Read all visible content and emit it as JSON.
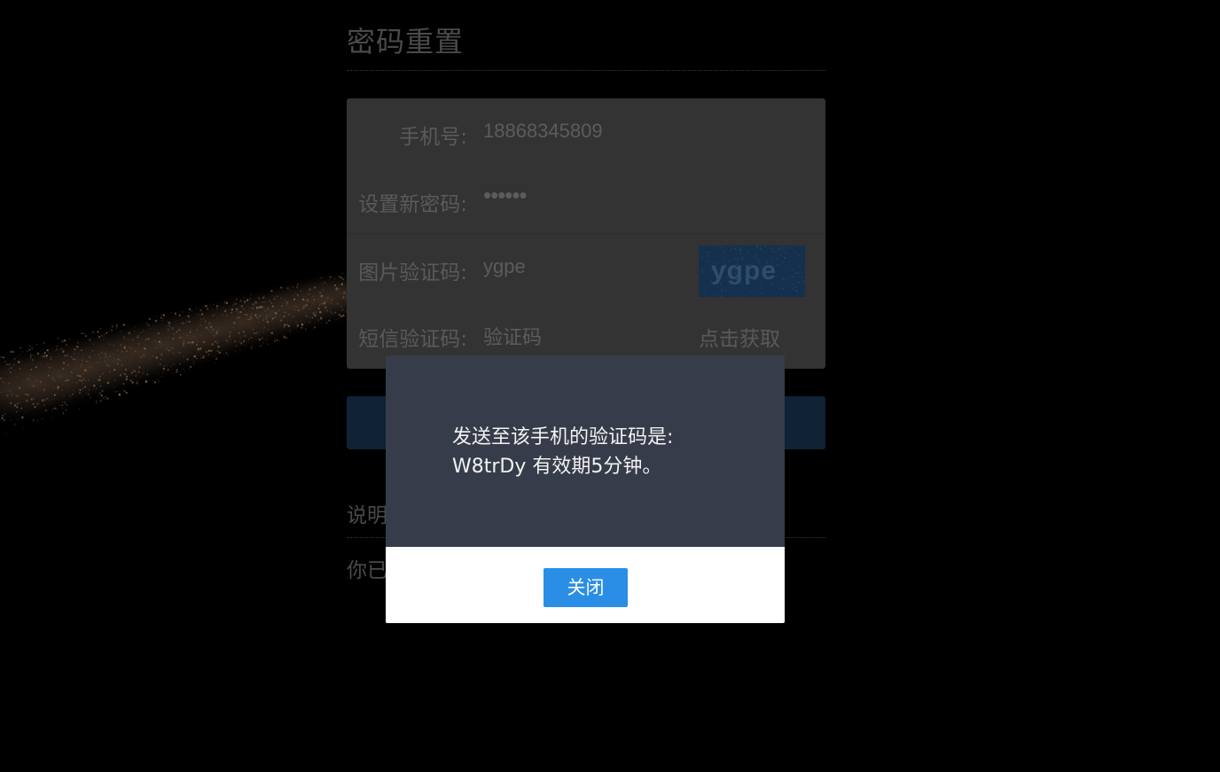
{
  "page": {
    "title": "密码重置"
  },
  "form": {
    "phone": {
      "label": "手机号:",
      "value": "18868345809"
    },
    "new_password": {
      "label": "设置新密码:",
      "value": "••••••"
    },
    "image_captcha": {
      "label": "图片验证码:",
      "value": "ygpe",
      "image_text": "ygpe"
    },
    "sms_code": {
      "label": "短信验证码:",
      "placeholder": "验证码",
      "get_code_label": "点击获取"
    }
  },
  "description": {
    "title": "说明",
    "text": "你已"
  },
  "modal": {
    "message_line1": "发送至该手机的验证码是:",
    "message_line2": "W8trDy 有效期5分钟。",
    "close_label": "关闭"
  },
  "colors": {
    "background": "#000000",
    "modal_body": "#373c4a",
    "close_button": "#2b8ee6",
    "captcha_bg": "#14304e"
  }
}
